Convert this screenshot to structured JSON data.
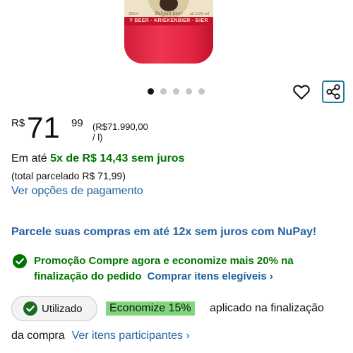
{
  "product_image": {
    "band_text": "Y BEER · KRIEKENBIER · BIER",
    "subtitle": "Belgian beer",
    "volume_left": "355ml",
    "volume_right": "alc 3,5% vol"
  },
  "carousel": {
    "count": 5,
    "active_index": 0
  },
  "actions": {
    "wishlist_icon": "heart-outline-icon",
    "share_icon": "share-icon"
  },
  "price": {
    "currency": "R$",
    "whole": "71",
    "fraction": "99",
    "unit_price": "(R$71.990,00 / l)"
  },
  "installments": {
    "prefix": "Em até",
    "highlight": "5x de R$ 14,43 sem juros",
    "total": "(total parcelado R$ 71,99)",
    "link": "Ver opções de pagamento"
  },
  "nupay": {
    "text": "Parcele suas compras em até 12x sem juros com NuPay!"
  },
  "promotion": {
    "line1": "Promoção Compre agora e economize mais 20% na",
    "line2": "finalização do pedido",
    "link": "Comprar itens elegíveis ›"
  },
  "coupon": {
    "pill_label": "Utilizado",
    "badge": "Economize 15%",
    "applied_text": "aplicado na finalização",
    "line2_text": "da compra",
    "link": "Ver itens participantes ›"
  },
  "colors": {
    "green": "#007600",
    "link": "#2162a1",
    "badge_bg": "#7fd67b",
    "accent": "#1d7d96"
  }
}
